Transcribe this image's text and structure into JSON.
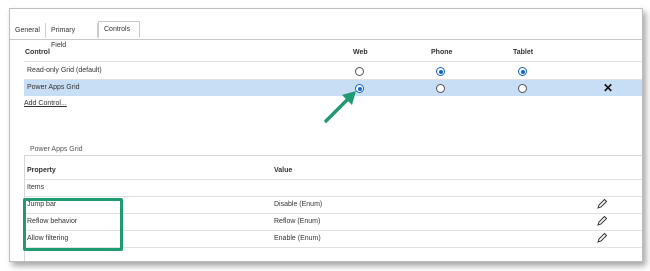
{
  "tabs": [
    {
      "label": "General",
      "active": false
    },
    {
      "label": "Primary Field",
      "active": false
    },
    {
      "label": "Controls",
      "active": true
    }
  ],
  "controls_table": {
    "headers": {
      "control": "Control",
      "web": "Web",
      "phone": "Phone",
      "tablet": "Tablet"
    },
    "rows": [
      {
        "label": "Read-only Grid (default)",
        "web": false,
        "phone": true,
        "tablet": true,
        "selected": false
      },
      {
        "label": "Power Apps Grid",
        "web": true,
        "phone": false,
        "tablet": false,
        "selected": true
      }
    ],
    "remove_glyph": "✕",
    "add_control_label": "Add Control..."
  },
  "properties": {
    "section_title": "Power Apps Grid",
    "headers": {
      "property": "Property",
      "value": "Value"
    },
    "rows": [
      {
        "property": "Items",
        "value": ""
      },
      {
        "property": "Jump bar",
        "value": "Disable (Enum)"
      },
      {
        "property": "Reflow behavior",
        "value": "Reflow (Enum)"
      },
      {
        "property": "Allow filtering",
        "value": "Enable (Enum)"
      }
    ]
  },
  "colors": {
    "selection": "#c7def4",
    "radio_selected": "#1565c0",
    "annotation_green": "#1f9a73"
  }
}
